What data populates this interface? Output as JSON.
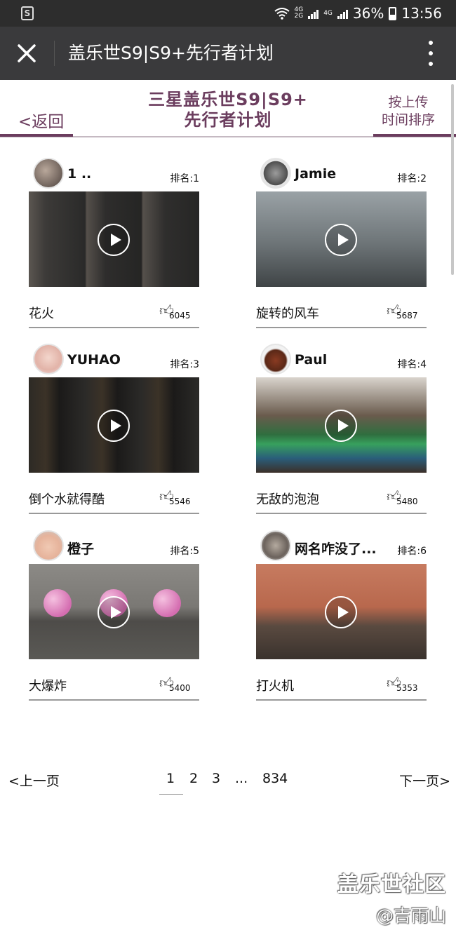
{
  "status_bar": {
    "network": "4G\n2G",
    "network2": "4G",
    "battery": "36%",
    "time": "13:56",
    "app_icon": "S"
  },
  "title_bar": {
    "title": "盖乐世S9|S9+先行者计划"
  },
  "header": {
    "title_line1": "三星盖乐世S9|S9+",
    "title_line2": "先行者计划",
    "back_label": "<返回",
    "sort_line1": "按上传",
    "sort_line2": "时间排序",
    "accent": "#6b3d5e"
  },
  "videos": [
    {
      "username": "1                ..",
      "rank": "排名:1",
      "title": "花火",
      "likes": "6045"
    },
    {
      "username": "Jamie",
      "rank": "排名:2",
      "title": "旋转的风车",
      "likes": "5687"
    },
    {
      "username": "YUHAO",
      "rank": "排名:3",
      "title": "倒个水就得酷",
      "likes": "5546"
    },
    {
      "username": "Paul",
      "rank": "排名:4",
      "title": "无敌的泡泡",
      "likes": "5480"
    },
    {
      "username": "橙子",
      "rank": "排名:5",
      "title": "大爆炸",
      "likes": "5400"
    },
    {
      "username": "网名咋没了...",
      "rank": "排名:6",
      "title": "打火机",
      "likes": "5353"
    }
  ],
  "pagination": {
    "prev": "<上一页",
    "next": "下一页>",
    "pages": [
      "1",
      "2",
      "3",
      "...",
      "834"
    ],
    "current": "1"
  },
  "watermark": {
    "line1": "盖乐世社区",
    "line2": "@吉雨山"
  }
}
